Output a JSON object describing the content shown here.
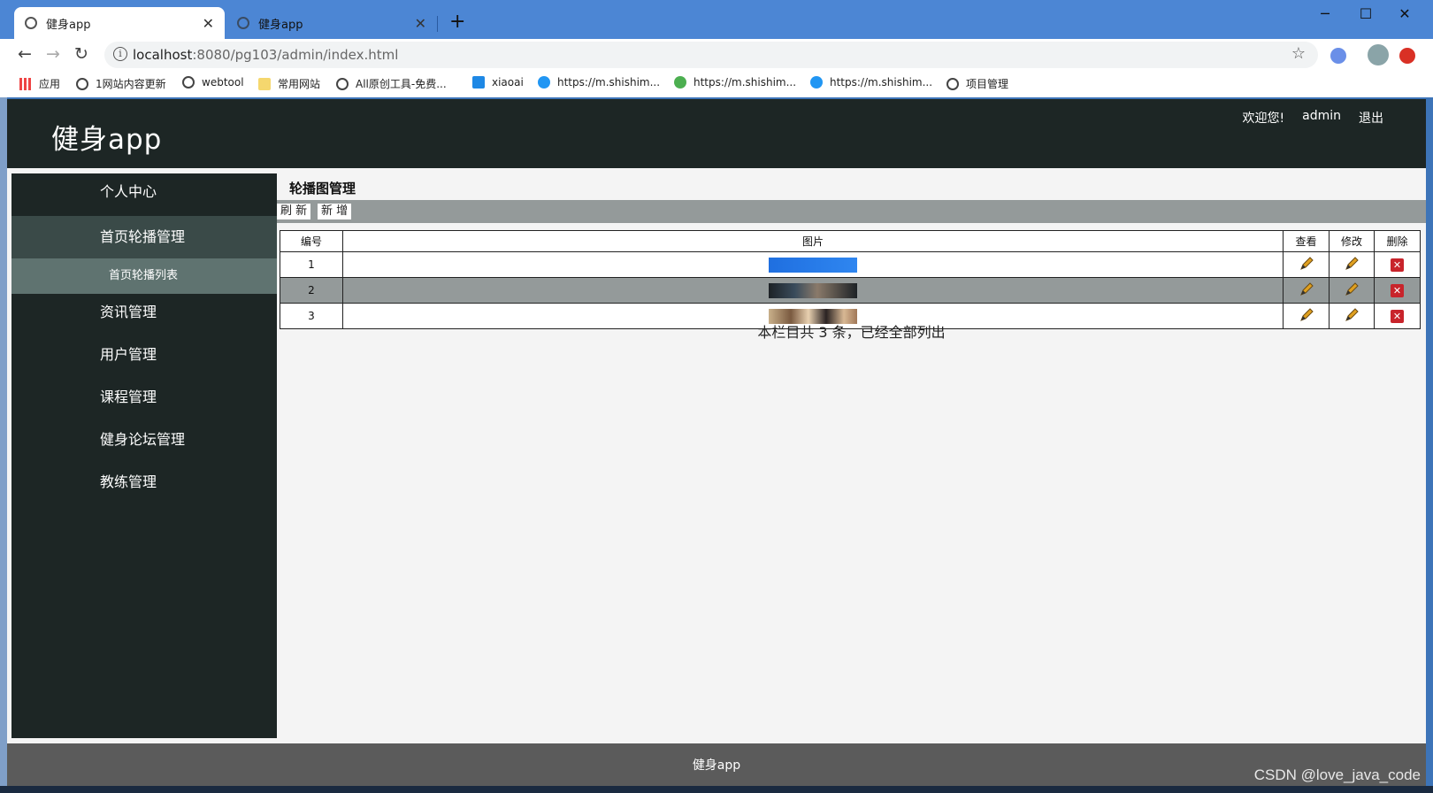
{
  "browser": {
    "tabs": [
      {
        "title": "健身app",
        "active": true
      },
      {
        "title": "健身app",
        "active": false
      }
    ],
    "url_host": "localhost",
    "url_path": ":8080/pg103/admin/index.html",
    "bookmarks": [
      {
        "label": "应用",
        "icon": "apps-grid-icon"
      },
      {
        "label": "1网站内容更新",
        "icon": "globe-icon"
      },
      {
        "label": "webtool",
        "icon": "globe-icon"
      },
      {
        "label": "常用网站",
        "icon": "folder-icon"
      },
      {
        "label": "All原创工具-免费...",
        "icon": "globe-icon"
      },
      {
        "label": "xiaoai",
        "icon": "p-logo-icon"
      },
      {
        "label": "https://m.shishim...",
        "icon": "blue-c-icon"
      },
      {
        "label": "https://m.shishim...",
        "icon": "wechat-icon"
      },
      {
        "label": "https://m.shishim...",
        "icon": "blue-c-icon"
      },
      {
        "label": "项目管理",
        "icon": "globe-icon"
      }
    ]
  },
  "header": {
    "brand": "健身app",
    "welcome": "欢迎您!",
    "username": "admin",
    "logout": "退出"
  },
  "sidebar": {
    "items": [
      {
        "label": "个人中心"
      },
      {
        "label": "首页轮播管理",
        "open": true,
        "children": [
          {
            "label": "首页轮播列表"
          }
        ]
      },
      {
        "label": "资讯管理"
      },
      {
        "label": "用户管理"
      },
      {
        "label": "课程管理"
      },
      {
        "label": "健身论坛管理"
      },
      {
        "label": "教练管理"
      }
    ]
  },
  "main": {
    "title": "轮播图管理",
    "actions": {
      "refresh": "刷 新",
      "add": "新 增"
    },
    "table": {
      "headers": [
        "编号",
        "图片",
        "查看",
        "修改",
        "删除"
      ],
      "rows": [
        {
          "id": "1",
          "image_colors": [
            "#1f6fe0",
            "#2f86f0"
          ]
        },
        {
          "id": "2",
          "image_colors": [
            "#1d2226",
            "#6b7680"
          ]
        },
        {
          "id": "3",
          "image_colors": [
            "#b89a7a",
            "#7a5a40"
          ]
        }
      ]
    },
    "summary": "本栏目共 3 条，已经全部列出"
  },
  "footer": {
    "text": "健身app"
  },
  "watermark": "CSDN @love_java_code",
  "colors": {
    "sidebar_bg": "#1d2625",
    "open_menu_bg": "#3a4a48",
    "submenu_bg": "#5f7370",
    "action_bar": "#949a9a",
    "footer_bg": "#5b5b5b",
    "delete_red": "#c8242b"
  }
}
